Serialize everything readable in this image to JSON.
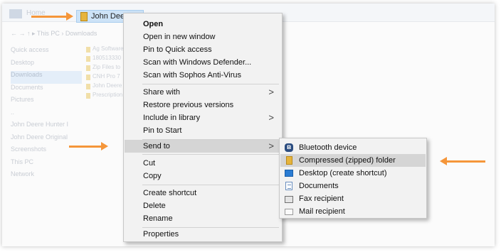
{
  "explorer": {
    "home_tab": "Home",
    "file_tab": "John Deere",
    "address": "← → ↑  ▸ This PC  ›  Downloads",
    "nav_items": [
      "Quick access",
      "Desktop",
      "Downloads",
      "Documents",
      "Pictures",
      "..",
      "John Deere Hunter I",
      "John Deere Original",
      "Screenshots",
      "This PC",
      "Network"
    ],
    "files": [
      "Ag Software",
      "180513330",
      "Zip Files to",
      "CNH Pro 7",
      "John Deere",
      "Prescription"
    ]
  },
  "context_menu": {
    "open": "Open",
    "open_new_window": "Open in new window",
    "pin_quick_access": "Pin to Quick access",
    "scan_defender": "Scan with Windows Defender...",
    "scan_sophos": "Scan with Sophos Anti-Virus",
    "share_with": "Share with",
    "restore_versions": "Restore previous versions",
    "include_library": "Include in library",
    "pin_start": "Pin to Start",
    "send_to": "Send to",
    "cut": "Cut",
    "copy": "Copy",
    "create_shortcut": "Create shortcut",
    "delete": "Delete",
    "rename": "Rename",
    "properties": "Properties",
    "chevron": ">"
  },
  "send_to_menu": {
    "bluetooth": "Bluetooth device",
    "compressed": "Compressed (zipped) folder",
    "desktop": "Desktop (create shortcut)",
    "documents": "Documents",
    "fax": "Fax recipient",
    "mail": "Mail recipient"
  },
  "icons": {
    "bluetooth": "bluetooth-icon",
    "zip": "zip-folder-icon",
    "desktop": "desktop-icon",
    "documents": "documents-icon",
    "fax": "fax-icon",
    "mail": "mail-icon"
  },
  "colors": {
    "arrow": "#f5963a",
    "highlight": "#d5d5d5",
    "menu_bg": "#f2f2f2"
  }
}
